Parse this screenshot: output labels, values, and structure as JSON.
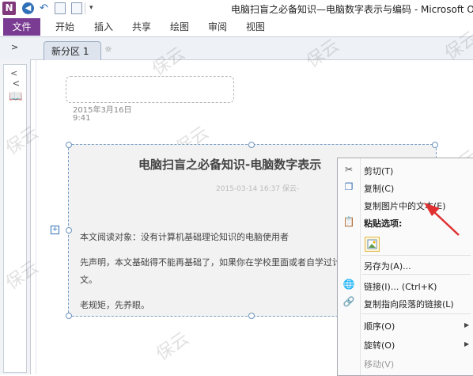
{
  "window": {
    "title": "电脑扫盲之必备知识—电脑数字表示与编码 - Microsoft One",
    "app_logo": "N"
  },
  "ribbon": {
    "file_label": "文件",
    "tabs": [
      "开始",
      "插入",
      "共享",
      "绘图",
      "审阅",
      "视图"
    ]
  },
  "sections": {
    "active_tab": "新分区 1",
    "add_tab_symbol": "☼"
  },
  "sidebar": {
    "vertical_text": "V"
  },
  "page": {
    "date": "2015年3月16日",
    "time": "9:41"
  },
  "image": {
    "title": "电脑扫盲之必备知识-电脑数字表示",
    "meta": "2015-03-14 16:37   保云-",
    "lines": [
      "本文阅读对象：没有计算机基础理论知识的电脑使用者",
      "先声明，本文基础得不能再基础了，如果你在学校里面或者自学过计",
      "文。",
      "老规矩，先养眼。"
    ]
  },
  "context_menu": {
    "items": {
      "cut": "剪切(T)",
      "copy": "复制(C)",
      "copy_text_from_picture": "复制图片中的文本(E)",
      "paste_options": "粘贴选项:",
      "save_as": "另存为(A)...",
      "link": "链接(I)...   (Ctrl+K)",
      "copy_link_to_paragraph": "复制指向段落的链接(L)",
      "order": "顺序(O)",
      "rotate": "旋转(O)",
      "move": "移动(V)"
    }
  },
  "watermark_text": "保云",
  "colors": {
    "file_tab": "#7a3b92",
    "arrow": "#e03030",
    "selection": "#6b93bd"
  }
}
